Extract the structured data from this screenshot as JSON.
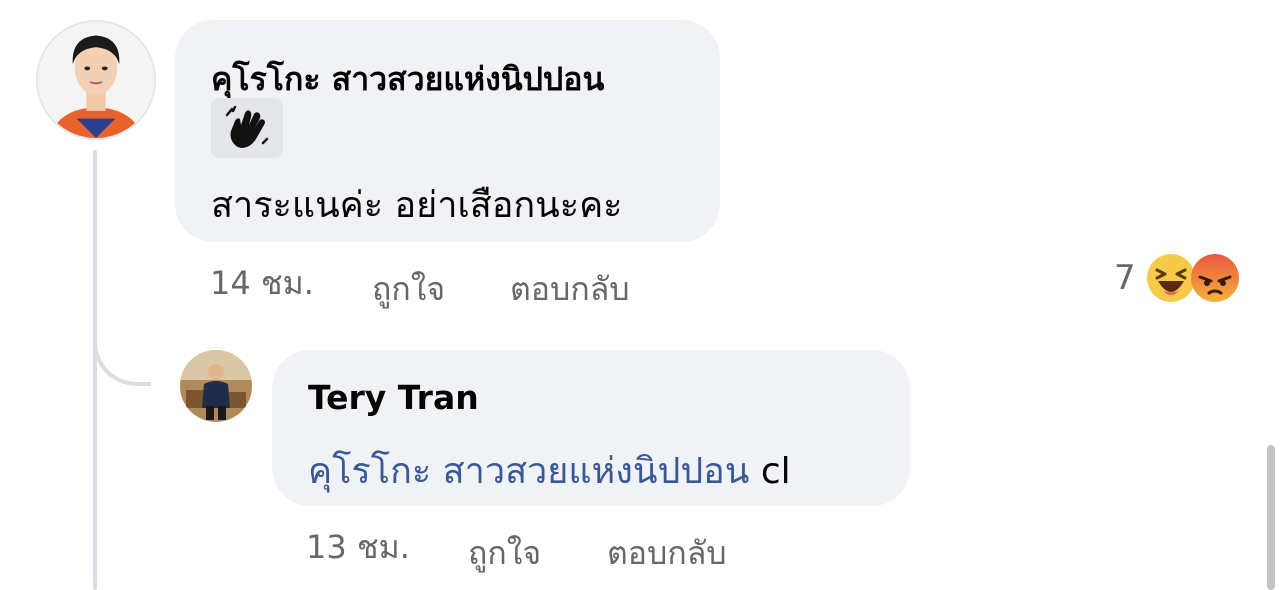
{
  "comment": {
    "author": "คุโรโกะ สาวสวยแห่งนิปปอน",
    "sticker_icon": "waving-hand-icon",
    "text": "สาระแนค่ะ อย่าเสือกนะคะ",
    "time": "14 ชม.",
    "like_label": "ถูกใจ",
    "reply_label": "ตอบกลับ",
    "reaction_count": "7",
    "reactions": [
      "haha",
      "angry"
    ]
  },
  "reply": {
    "author": "Tery Tran",
    "mention": "คุโรโกะ สาวสวยแห่งนิปปอน",
    "text": " cl",
    "time": "13 ชม.",
    "like_label": "ถูกใจ",
    "reply_label": "ตอบกลับ"
  },
  "colors": {
    "bubble": "#f0f2f5",
    "mention": "#385898",
    "meta": "#65676b",
    "thread_line": "#dadde1"
  }
}
